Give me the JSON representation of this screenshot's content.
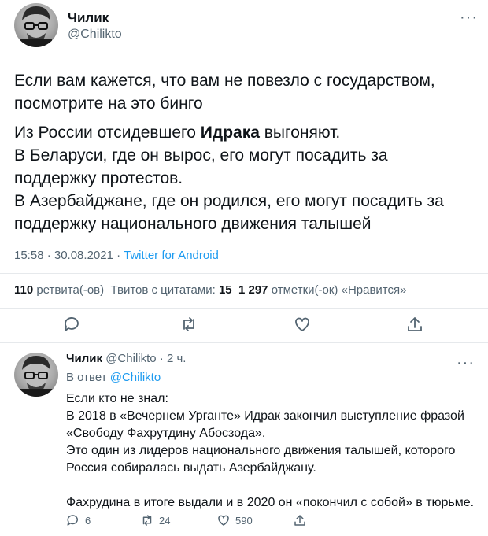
{
  "tweet": {
    "author_name": "Чилик",
    "author_handle": "@Chilikto",
    "line1": "Если вам кажется, что вам не повезло с государством,",
    "line2": "посмотрите на это бинго",
    "p2_prefix": "Из России отсидевшего ",
    "p2_bold": "Идрака",
    "p2_suffix": " выгоняют.",
    "p3_line1": "В Беларуси, где он вырос, его могут посадить за",
    "p3_line2": "поддержку протестов.",
    "p4_line1": "В Азербайджане, где он родился, его могут посадить за",
    "p4_line2": "поддержку национального движения талышей",
    "time": "15:58 · 30.08.2021 · ",
    "source": "Twitter for Android",
    "retweets_count": "110",
    "retweets_label": "ретвита(-ов)",
    "quotes_label": "Твитов с цитатами:",
    "quotes_count": "15",
    "likes_count": "1 297",
    "likes_label": "отметки(-ок) «Нравится»"
  },
  "reply": {
    "author_name": "Чилик",
    "author_handle": "@Chilikto",
    "age": "· 2 ч.",
    "in_reply_prefix": "В ответ ",
    "in_reply_handle": "@Chilikto",
    "l1": "Если кто не знал:",
    "l2": "В 2018 в «Вечернем Урганте» Идрак закончил выступление фразой",
    "l3": "«Свободу Фахрутдину Абосзода».",
    "l4": "Это один из лидеров национального движения талышей, которого",
    "l5": "Россия собиралась выдать Азербайджану.",
    "l6": "Фахрудина в итоге выдали и в 2020 он «покончил с собой» в тюрьме.",
    "reply_count": "6",
    "retweet_count": "24",
    "like_count": "590"
  }
}
